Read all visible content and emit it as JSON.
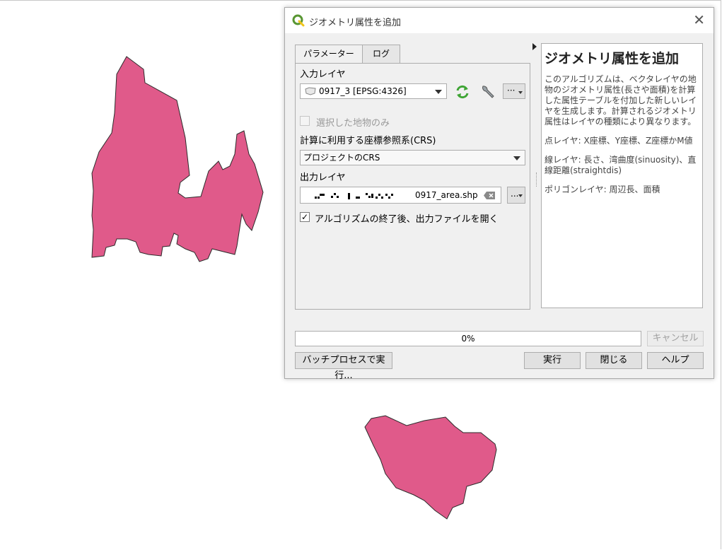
{
  "dialog": {
    "title": "ジオメトリ属性を追加",
    "tabs": [
      {
        "label": "パラメーター",
        "active": true
      },
      {
        "label": "ログ",
        "active": false
      }
    ],
    "input_layer": {
      "label": "入力レイヤ",
      "value": "0917_3 [EPSG:4326]",
      "selected_only_label": "選択した地物のみ",
      "selected_only_checked": false
    },
    "crs": {
      "label": "計算に利用する座標参照系(CRS)",
      "value": "プロジェクトのCRS"
    },
    "output_layer": {
      "label": "出力レイヤ",
      "value": "0917_area.shp",
      "browse_label": "..."
    },
    "open_output": {
      "label": "アルゴリズムの終了後、出力ファイルを開く",
      "checked": true
    },
    "help": {
      "title": "ジオメトリ属性を追加",
      "paragraphs": [
        "このアルゴリズムは、ベクタレイヤの地物のジオメトリ属性(長さや面積)を計算した属性テーブルを付加した新しいレイヤを生成します。計算されるジオメトリ属性はレイヤの種類により異なります。",
        "点レイヤ: X座標、Y座標、Z座標かM値",
        "線レイヤ: 長さ、湾曲度(sinuosity)、直線距離(straightdis)",
        "ポリゴンレイヤ: 周辺長、面積"
      ]
    },
    "progress": {
      "value": 0,
      "text": "0%"
    },
    "buttons": {
      "cancel": "キャンセル",
      "batch": "バッチプロセスで実行...",
      "run": "実行",
      "close": "閉じる",
      "help": "ヘルプ"
    },
    "options_label": "···"
  },
  "colors": {
    "polygon_fill": "#e05a8a",
    "polygon_stroke": "#2b2b2b",
    "qgis_green": "#589632",
    "refresh_green": "#3fa535"
  }
}
